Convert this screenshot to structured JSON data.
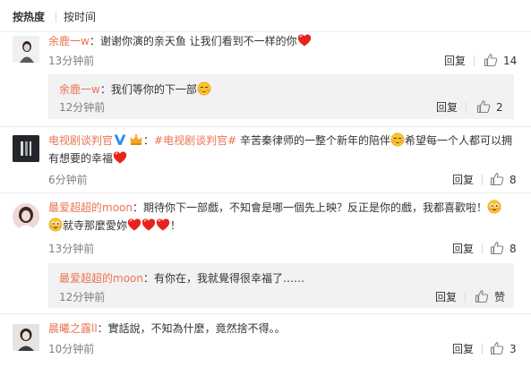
{
  "sort": {
    "by_hot": "按热度",
    "by_time": "按时间"
  },
  "comments": [
    {
      "name": "余鹿一w",
      "text": "：谢谢你演的亲天鱼 让我们看到不一样的你",
      "time": "13分钟前",
      "reply": "回复",
      "likes": "14",
      "sub": {
        "name": "余鹿一w",
        "text": "：我们等你的下一部",
        "time": "12分钟前",
        "reply": "回复",
        "likes": "2"
      }
    },
    {
      "name": "电视剧谈判官",
      "topic": "#电视剧谈判官#",
      "text_a": " 辛苦秦律师的一整个新年的陪伴",
      "text_b": "希望每一个人都可以拥有想要的幸福",
      "time": "6分钟前",
      "reply": "回复",
      "likes": "8"
    },
    {
      "name": "最爱超超的moon",
      "text_a": "：期待你下一部戲，不知會是哪一個先上映？反正是你的戲，我都喜歡啦！",
      "text_b": "就寺那麼愛妳",
      "text_c": "！",
      "time": "13分钟前",
      "reply": "回复",
      "likes": "8",
      "sub": {
        "name": "最爱超超的moon",
        "text": "：有你在，我就覺得很幸福了……",
        "time": "12分钟前",
        "reply": "回复",
        "likes": "赞"
      }
    },
    {
      "name": "晨曦之露ll",
      "text": "：實話說，不知為什麼，竟然捨不得。。",
      "time": "10分钟前",
      "reply": "回复",
      "likes": "3"
    }
  ],
  "icons": {
    "like": "thumbs-up-icon",
    "verified": "verified-v-badge-icon",
    "heart": "red-heart-emoji",
    "smile": "smile-emoji"
  },
  "colors": {
    "name": "#eb7350",
    "text": "#333333",
    "time": "#808080",
    "sub_bg": "#f2f2f5",
    "verified": "#3090f0",
    "heart": "#e8231c"
  }
}
